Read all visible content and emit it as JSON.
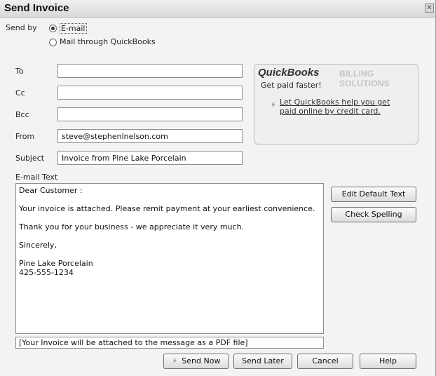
{
  "window": {
    "title": "Send Invoice",
    "close_glyph": "✕"
  },
  "send_by": {
    "label": "Send by",
    "options": [
      {
        "label": "E-mail",
        "selected": true
      },
      {
        "label": "Mail through QuickBooks",
        "selected": false
      }
    ]
  },
  "fields": {
    "to": {
      "label": "To",
      "value": ""
    },
    "cc": {
      "label": "Cc",
      "value": ""
    },
    "bcc": {
      "label": "Bcc",
      "value": ""
    },
    "from": {
      "label": "From",
      "value": "steve@stephenlnelson.com"
    },
    "subject": {
      "label": "Subject",
      "value": "Invoice from Pine Lake Porcelain"
    }
  },
  "promo": {
    "logo": "QuickBooks",
    "subtitle": "BILLING SOLUTIONS",
    "text": "Get paid faster!",
    "link": "Let QuickBooks help you get paid online by credit card."
  },
  "email_text": {
    "label": "E-mail Text",
    "lines": [
      "Dear Customer :",
      "Your invoice is attached.  Please remit payment at your earliest convenience.",
      "Thank you for your business - we appreciate it very much.",
      "Sincerely,",
      "Pine Lake Porcelain",
      "425-555-1234"
    ]
  },
  "attachment_note": "[Your Invoice will be attached to the message as a PDF file]",
  "buttons": {
    "edit_default_text": "Edit Default Text",
    "check_spelling": "Check Spelling",
    "send_now": "Send Now",
    "send_later": "Send Later",
    "cancel": "Cancel",
    "help": "Help"
  }
}
